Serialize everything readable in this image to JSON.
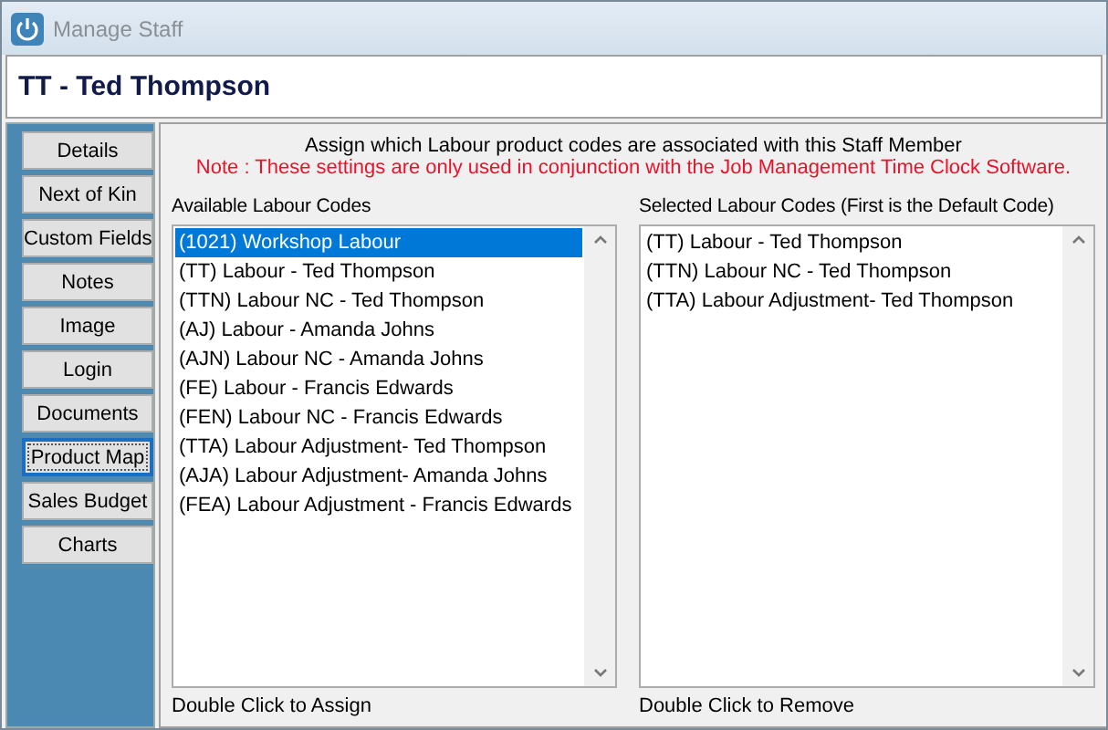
{
  "window": {
    "title": "Manage Staff"
  },
  "header": {
    "title": "TT - Ted Thompson"
  },
  "sidebar": {
    "items": [
      {
        "label": "Details",
        "selected": false
      },
      {
        "label": "Next of Kin",
        "selected": false
      },
      {
        "label": "Custom Fields",
        "selected": false
      },
      {
        "label": "Notes",
        "selected": false
      },
      {
        "label": "Image",
        "selected": false
      },
      {
        "label": "Login",
        "selected": false
      },
      {
        "label": "Documents",
        "selected": false
      },
      {
        "label": "Product Map",
        "selected": true
      },
      {
        "label": "Sales Budget",
        "selected": false
      },
      {
        "label": "Charts",
        "selected": false
      }
    ]
  },
  "content": {
    "instruction": "Assign which Labour product codes are associated with this Staff Member",
    "note": "Note : These settings are only used in conjunction with the Job Management Time Clock Software.",
    "available": {
      "label": "Available Labour Codes",
      "hint": "Double Click to Assign",
      "items": [
        {
          "text": "(1021) Workshop Labour",
          "selected": true
        },
        {
          "text": "(TT) Labour - Ted Thompson",
          "selected": false
        },
        {
          "text": "(TTN) Labour NC - Ted Thompson",
          "selected": false
        },
        {
          "text": "(AJ) Labour - Amanda Johns",
          "selected": false
        },
        {
          "text": "(AJN) Labour NC - Amanda Johns",
          "selected": false
        },
        {
          "text": "(FE) Labour - Francis Edwards",
          "selected": false
        },
        {
          "text": "(FEN) Labour NC - Francis Edwards",
          "selected": false
        },
        {
          "text": "(TTA) Labour Adjustment- Ted Thompson",
          "selected": false
        },
        {
          "text": "(AJA) Labour Adjustment- Amanda Johns",
          "selected": false
        },
        {
          "text": "(FEA) Labour Adjustment - Francis Edwards",
          "selected": false
        }
      ]
    },
    "selected": {
      "label": "Selected Labour Codes (First is the Default Code)",
      "hint": "Double Click to Remove",
      "items": [
        {
          "text": "(TT) Labour - Ted Thompson",
          "selected": false
        },
        {
          "text": "(TTN) Labour NC - Ted Thompson",
          "selected": false
        },
        {
          "text": "(TTA) Labour Adjustment- Ted Thompson",
          "selected": false
        }
      ]
    }
  }
}
